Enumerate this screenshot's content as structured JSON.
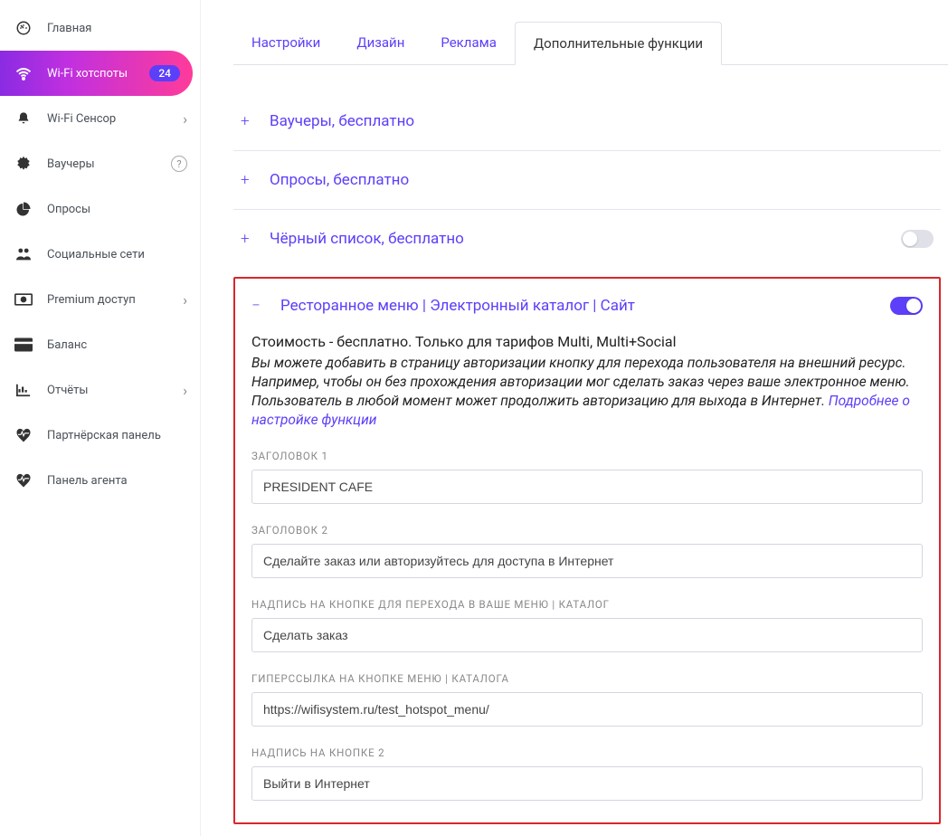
{
  "sidebar": {
    "items": [
      {
        "icon": "dashboard",
        "label": "Главная"
      },
      {
        "icon": "wifi",
        "label": "Wi-Fi хотспоты",
        "badge": "24",
        "active": true
      },
      {
        "icon": "bell",
        "label": "Wi-Fi Сенсор",
        "chev": true
      },
      {
        "icon": "gear",
        "label": "Ваучеры",
        "help": true
      },
      {
        "icon": "pie",
        "label": "Опросы"
      },
      {
        "icon": "people",
        "label": "Социальные сети"
      },
      {
        "icon": "money",
        "label": "Premium доступ",
        "chev": true
      },
      {
        "icon": "card",
        "label": "Баланс"
      },
      {
        "icon": "chart",
        "label": "Отчёты",
        "chev": true
      },
      {
        "icon": "heart",
        "label": "Партнёрская панель"
      },
      {
        "icon": "heart",
        "label": "Панель агента"
      }
    ]
  },
  "tabs": [
    {
      "label": "Настройки"
    },
    {
      "label": "Дизайн"
    },
    {
      "label": "Реклама"
    },
    {
      "label": "Дополнительные функции",
      "active": true
    }
  ],
  "accordions": {
    "vouchers": {
      "title": "Ваучеры, бесплатно"
    },
    "surveys": {
      "title": "Опросы, бесплатно"
    },
    "blacklist": {
      "title": "Чёрный список, бесплатно"
    },
    "menu": {
      "title": "Ресторанное меню | Электронный каталог | Сайт",
      "price_line": "Стоимость - бесплатно. Только для тарифов Multi, Multi+Social",
      "desc": "Вы можете добавить в страницу авторизации кнопку для перехода пользователя на внешний ресурс. Например, чтобы он без прохождения авторизации мог сделать заказ через ваше электронное меню. Пользователь в любой момент может продолжить авторизацию для выхода в Интернет. ",
      "link_text": "Подробнее о настройке функции",
      "fields": {
        "h1": {
          "label": "ЗАГОЛОВОК 1",
          "value": "PRESIDENT CAFE"
        },
        "h2": {
          "label": "ЗАГОЛОВОК 2",
          "value": "Сделайте заказ или авторизуйтесь для доступа в Интернет"
        },
        "btn_label": {
          "label": "НАДПИСЬ НА КНОПКЕ ДЛЯ ПЕРЕХОДА В ВАШЕ МЕНЮ | КАТАЛОГ",
          "value": "Сделать заказ"
        },
        "btn_link": {
          "label": "ГИПЕРССЫЛКА НА КНОПКЕ МЕНЮ | КАТАЛОГА",
          "value": "https://wifisystem.ru/test_hotspot_menu/"
        },
        "btn2": {
          "label": "НАДПИСЬ НА КНОПКЕ 2",
          "value": "Выйти в Интернет"
        }
      }
    }
  }
}
